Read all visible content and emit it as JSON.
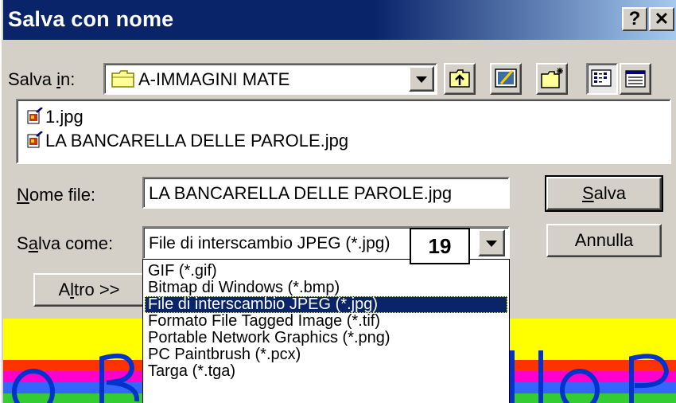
{
  "window": {
    "title": "Salva con nome",
    "help_label": "?",
    "close_label": "✕"
  },
  "save_in": {
    "label_pre": "Salva ",
    "label_key": "i",
    "label_post": "n:",
    "value": "A-IMMAGINI MATE"
  },
  "files": [
    {
      "name": "1.jpg",
      "icon": "jpeg-file-icon"
    },
    {
      "name": "LA BANCARELLA DELLE PAROLE.jpg",
      "icon": "jpeg-file-icon"
    }
  ],
  "filename": {
    "label_key": "N",
    "label_post": "ome file:",
    "value": "LA BANCARELLA DELLE PAROLE.jpg"
  },
  "save_as": {
    "label_pre": "S",
    "label_key": "a",
    "label_post": "lva come:",
    "value": "File di interscambio JPEG (*.jpg)"
  },
  "buttons": {
    "save_key": "S",
    "save_post": "alva",
    "cancel": "Annulla",
    "other_pre": "A",
    "other_key": "l",
    "other_post": "tro >>"
  },
  "dropdown_options": [
    "GIF (*.gif)",
    "Bitmap di Windows (*.bmp)",
    "File di interscambio JPEG (*.jpg)",
    "Formato File Tagged Image (*.tif)",
    "Portable Network Graphics (*.png)",
    "PC Paintbrush (*.pcx)",
    "Targa (*.tga)"
  ],
  "selected_option_index": 2,
  "annotation_badge": "19",
  "colors": {
    "title_bar": "#0a246a",
    "selection": "#0a246a",
    "dialog_face": "#d4d0c8"
  }
}
